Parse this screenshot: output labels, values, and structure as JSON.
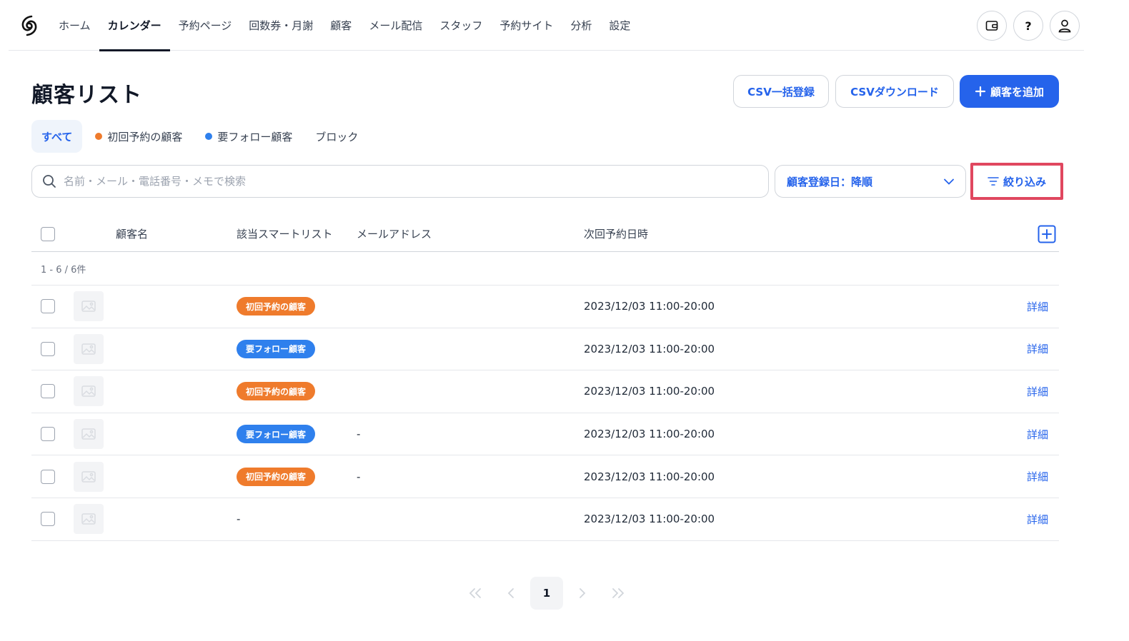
{
  "nav": {
    "items": [
      {
        "label": "ホーム",
        "active": false
      },
      {
        "label": "カレンダー",
        "active": true
      },
      {
        "label": "予約ページ",
        "active": false
      },
      {
        "label": "回数券・月謝",
        "active": false
      },
      {
        "label": "顧客",
        "active": false
      },
      {
        "label": "メール配信",
        "active": false
      },
      {
        "label": "スタッフ",
        "active": false
      },
      {
        "label": "予約サイト",
        "active": false
      },
      {
        "label": "分析",
        "active": false
      },
      {
        "label": "設定",
        "active": false
      }
    ],
    "help_label": "?"
  },
  "header": {
    "title": "顧客リスト",
    "csv_import_label": "CSV一括登録",
    "csv_download_label": "CSVダウンロード",
    "add_customer_label": "顧客を追加"
  },
  "segments": [
    {
      "label": "すべて",
      "active": true,
      "dot_color": ""
    },
    {
      "label": "初回予約の顧客",
      "active": false,
      "dot_color": "#ef7b2c"
    },
    {
      "label": "要フォロー顧客",
      "active": false,
      "dot_color": "#2f80ed"
    },
    {
      "label": "ブロック",
      "active": false,
      "dot_color": ""
    }
  ],
  "search": {
    "placeholder": "名前・メール・電話番号・メモで検索",
    "value": ""
  },
  "sort": {
    "selected": "顧客登録日：降順"
  },
  "filter": {
    "label": "絞り込み"
  },
  "table": {
    "columns": {
      "name": "顧客名",
      "smart_list": "該当スマートリスト",
      "email": "メールアドレス",
      "next_reservation": "次回予約日時"
    },
    "count_text": "1 - 6 / 6件",
    "detail_label": "詳細",
    "tag_colors": {
      "初回予約の顧客": "#ef7b2c",
      "要フォロー顧客": "#2f80ed"
    },
    "rows": [
      {
        "name": "",
        "tag": "初回予約の顧客",
        "email": "",
        "next": "2023/12/03 11:00-20:00"
      },
      {
        "name": "",
        "tag": "要フォロー顧客",
        "email": "",
        "next": "2023/12/03 11:00-20:00"
      },
      {
        "name": "",
        "tag": "初回予約の顧客",
        "email": "",
        "next": "2023/12/03 11:00-20:00"
      },
      {
        "name": "",
        "tag": "要フォロー顧客",
        "email": "-",
        "next": "2023/12/03 11:00-20:00"
      },
      {
        "name": "",
        "tag": "初回予約の顧客",
        "email": "-",
        "next": "2023/12/03 11:00-20:00"
      },
      {
        "name": "",
        "tag": "",
        "no_tag_text": "-",
        "email": "",
        "next": "2023/12/03 11:00-20:00"
      }
    ]
  },
  "pagination": {
    "current": "1"
  }
}
